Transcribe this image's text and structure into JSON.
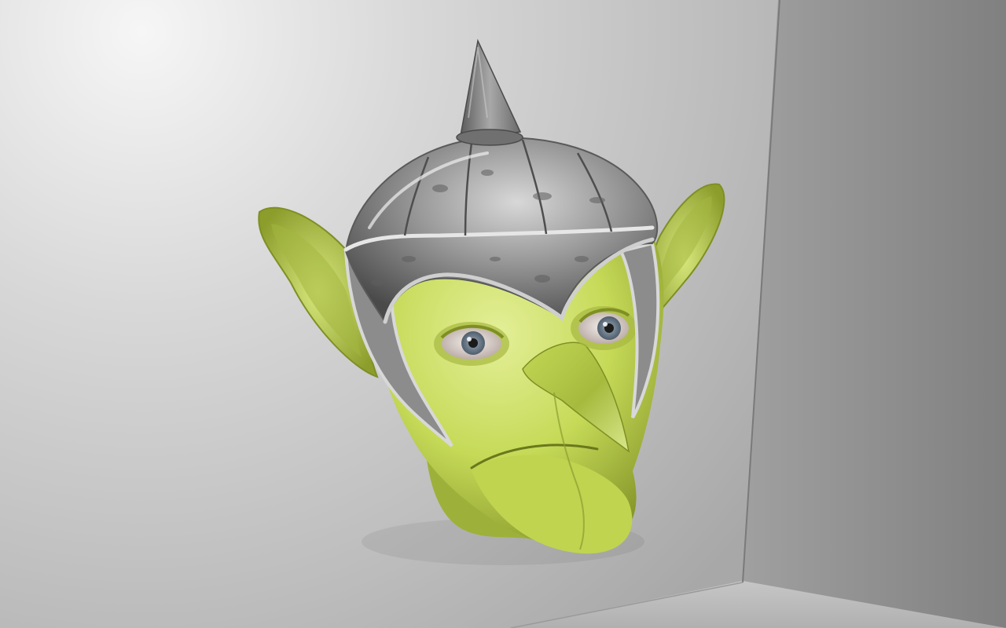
{
  "scene": {
    "subject": "goblin-head-with-helmet",
    "colors": {
      "skin": "#c8dc5a",
      "skin_shadow": "#7e8e22",
      "skin_highlight": "#e3ef96",
      "helmet_metal": "#8c8c8c",
      "helmet_highlight": "#e6e6e6",
      "helmet_dark": "#4a4a4a",
      "iris": "#6f7f90",
      "pupil": "#1b1b1b",
      "back_wall_light": "#f4f4f4",
      "back_wall_dark": "#a6a6a6",
      "side_wall": "#8a8a8a",
      "floor": "#b5b5b5"
    }
  }
}
